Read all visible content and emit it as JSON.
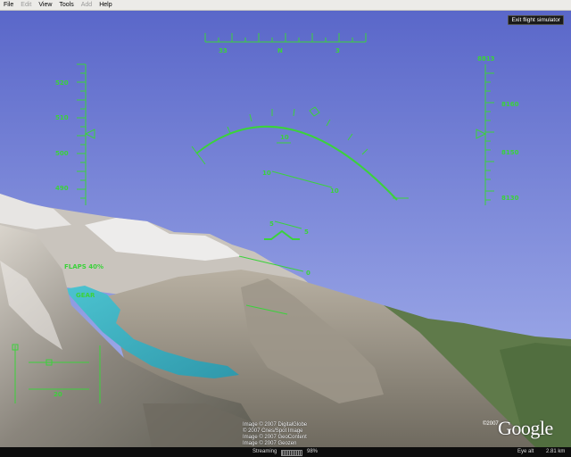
{
  "menu": {
    "file": "File",
    "edit": "Edit",
    "view": "View",
    "tools": "Tools",
    "add": "Add",
    "help": "Help"
  },
  "exit_button": "Exit flight simulator",
  "hud": {
    "heading_labels": [
      "33",
      "N",
      "3"
    ],
    "speed_labels": [
      "520",
      "510",
      "500",
      "490"
    ],
    "altitude_top": "8813",
    "altitude_labels": [
      "8160",
      "8150",
      "8130"
    ],
    "bank_label": "10",
    "pitch_labels": [
      "10",
      "10",
      "5",
      "5",
      "0"
    ],
    "flaps": "FLAPS 40%",
    "gear": "GEAR",
    "throttle_label": "20"
  },
  "attribution": [
    "Image © 2007 DigitalGlobe",
    "© 2007 Cnes/Spot Image",
    "Image © 2007 GeoContent",
    "Image © 2007 Geozen"
  ],
  "copyright_year": "©2007",
  "logo": "Google",
  "status": {
    "streaming": "Streaming",
    "streaming_percent": "98%",
    "eye_alt_label": "Eye alt",
    "eye_alt_value": "2.81 km"
  },
  "colors": {
    "hud": "#3bd23b",
    "sky_top": "#5a67c9",
    "sky_bottom": "#aab6ee",
    "lake": "#3fb0c0"
  }
}
